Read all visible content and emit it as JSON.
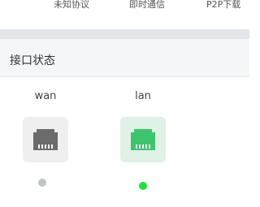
{
  "top_tabs": [
    {
      "label": "未知协议"
    },
    {
      "label": "即时通信"
    },
    {
      "label": "P2P下载"
    }
  ],
  "section": {
    "title": "接口状态"
  },
  "ports": [
    {
      "name": "wan",
      "status": "down",
      "icon": "ethernet-port-icon",
      "icon_color": "#6b6b6b",
      "box_color": "#efefef",
      "dot_color": "#bfc4c8"
    },
    {
      "name": "lan",
      "status": "up",
      "icon": "ethernet-port-icon",
      "icon_color": "#3ec46d",
      "box_color": "#dff2e5",
      "dot_color": "#1ee03a"
    }
  ]
}
